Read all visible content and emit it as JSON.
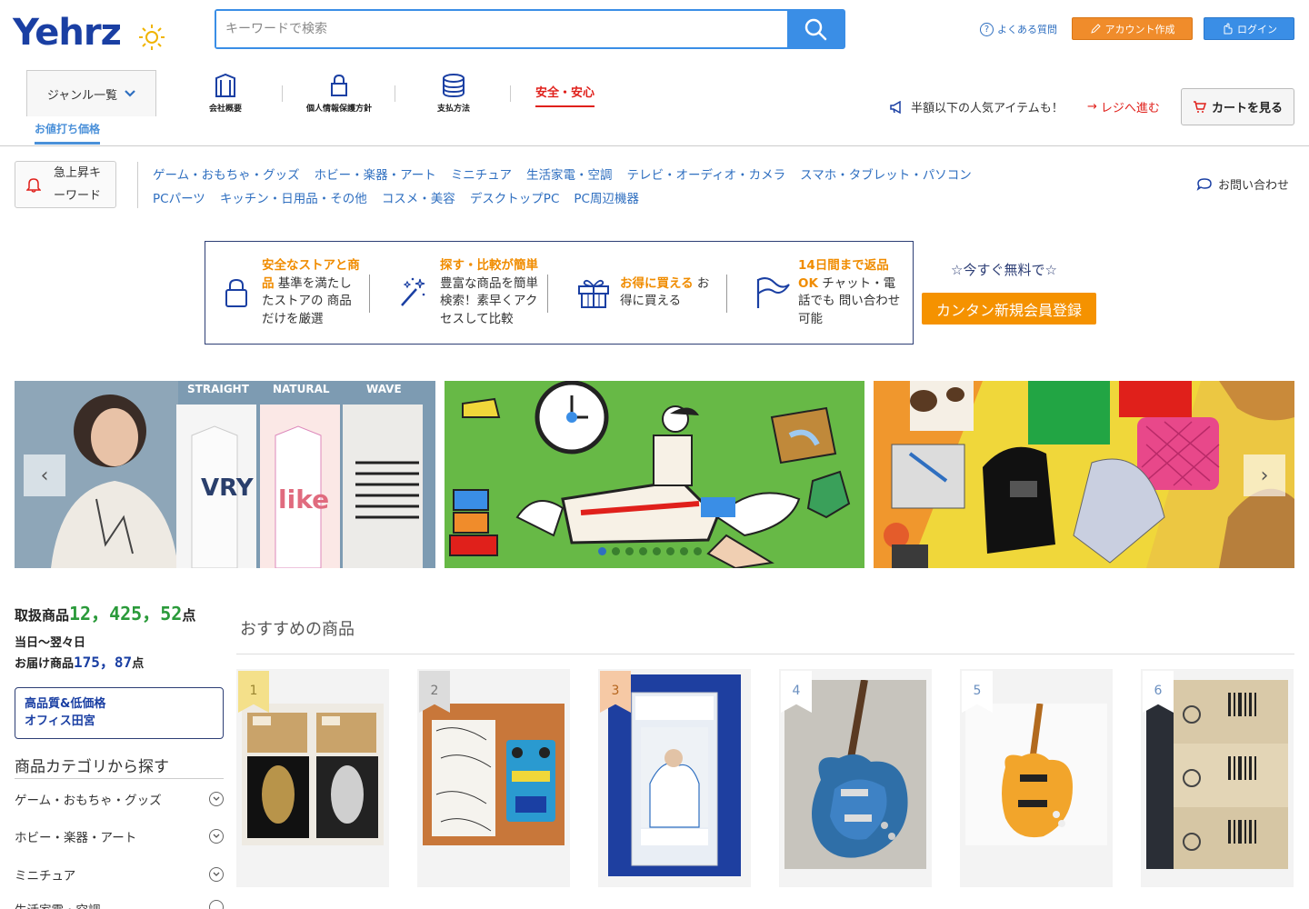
{
  "header": {
    "logo": "Yehrz",
    "search_placeholder": "キーワードで検索",
    "faq_label": "よくある質問",
    "account_button": "アカウント作成",
    "login_button": "ログイン"
  },
  "nav": {
    "genre_label": "ジャンル一覧",
    "items": [
      {
        "label": "会社概要",
        "icon": "building-icon"
      },
      {
        "label": "個人情報保護方針",
        "icon": "lock-icon"
      },
      {
        "label": "支払方法",
        "icon": "coins-icon"
      }
    ],
    "safety_label": "安全・安心",
    "promo_text": "半額以下の人気アイテムも！",
    "register_link": "レジへ進む",
    "cart_button": "カートを見る",
    "negotiation_label": "お値打ち価格"
  },
  "categories": {
    "trending_label_line1": "急上昇キ",
    "trending_label_line2": "ーワード",
    "row1": [
      "ゲーム・おもちゃ・グッズ",
      "ホビー・楽器・アート",
      "ミニチュア",
      "生活家電・空調",
      "テレビ・オーディオ・カメラ",
      "スマホ・タブレット・パソコン"
    ],
    "row2": [
      "PCパーツ",
      "キッチン・日用品・その他",
      "コスメ・美容",
      "デスクトップPC",
      "PC周辺機器"
    ],
    "contact_label": "お問い合わせ"
  },
  "features": [
    {
      "highlight": "安全なストアと商品",
      "text": "基準を満たしたストアの 商品だけを厳選",
      "icon": "lock-icon"
    },
    {
      "highlight": "探す・比較が簡単",
      "text": "豊富な商品を簡単検索！素早くアクセスして比較",
      "icon": "magic-wand-icon"
    },
    {
      "highlight": "お得に買える",
      "text": "お得に買える",
      "icon": "gift-icon"
    },
    {
      "highlight": "14日間まで返品OK",
      "text": "チャット・電話でも 問い合わせ可能",
      "icon": "flag-icon"
    }
  ],
  "signup": {
    "free_text": "☆今すぐ無料で☆",
    "button": "カンタン新規会員登録"
  },
  "banner": {
    "labels": [
      "STRAIGHT",
      "NATURAL",
      "WAVE"
    ],
    "prev": "‹",
    "next": "›",
    "slide_count": 8,
    "active_slide": 1
  },
  "sidebar": {
    "stat1_label": "取扱商品",
    "stat1_value": "12，425，52",
    "stat1_unit": "点",
    "stat2_line1": "当日～翌々日",
    "stat2_label": "お届け商品",
    "stat2_value": "175，87",
    "stat2_unit": "点",
    "office_line1": "高品質&低価格",
    "office_line2": "オフィス田宮",
    "category_title": "商品カテゴリから探す",
    "category_items": [
      "ゲーム・おもちゃ・グッズ",
      "ホビー・楽器・アート",
      "ミニチュア",
      "生活家電・空調"
    ]
  },
  "recommended": {
    "title": "おすすめの商品",
    "products": [
      {
        "rank": "1",
        "rank_color": "#f4e08a",
        "rank_text_color": "#9a8530"
      },
      {
        "rank": "2",
        "rank_color": "#dcdcdc",
        "rank_text_color": "#777777"
      },
      {
        "rank": "3",
        "rank_color": "#f6c9a5",
        "rank_text_color": "#b5651d"
      },
      {
        "rank": "4",
        "rank_color": "#ffffff",
        "rank_text_color": "#6a8fc0"
      },
      {
        "rank": "5",
        "rank_color": "#ffffff",
        "rank_text_color": "#6a8fc0"
      },
      {
        "rank": "6",
        "rank_color": "#ffffff",
        "rank_text_color": "#6a8fc0"
      }
    ]
  },
  "colors": {
    "brand": "#1a3fa3",
    "accent_blue": "#3a8ee6",
    "accent_orange": "#f08c2b",
    "alert_red": "#e0201b"
  }
}
